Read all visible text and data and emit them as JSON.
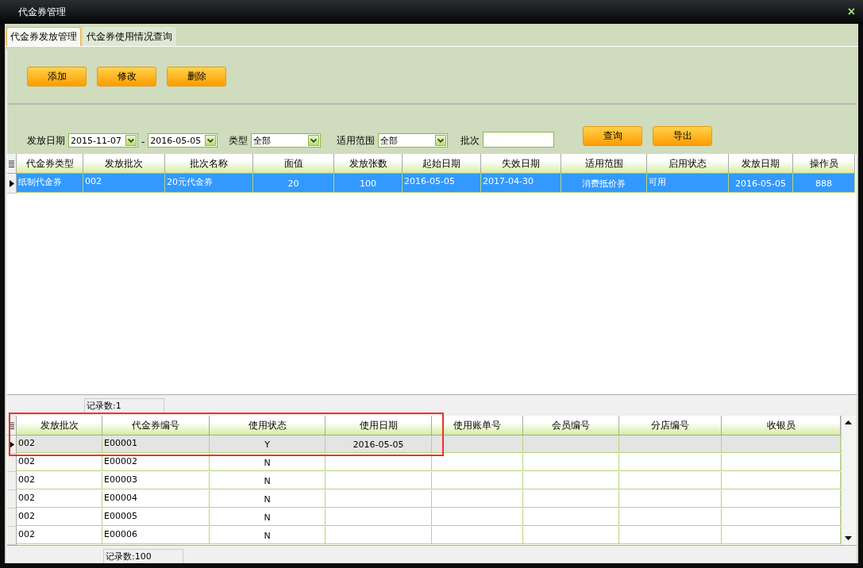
{
  "window": {
    "title": "代金券管理",
    "close": "×"
  },
  "tabs": [
    {
      "label": "代金券发放管理",
      "selected": true
    },
    {
      "label": "代金券使用情况查询",
      "selected": false
    }
  ],
  "toolbar": {
    "buttons": [
      "添加",
      "修改",
      "删除"
    ]
  },
  "filters": {
    "date_label": "发放日期",
    "date_from": "2015-11-07",
    "date_sep": "-",
    "date_to": "2016-05-05",
    "type_label": "类型",
    "type_value": "全部",
    "scope_label": "适用范围",
    "scope_value": "全部",
    "batch_label": "批次",
    "buttons": [
      "查询",
      "导出"
    ]
  },
  "issue_table": {
    "columns": [
      "代金券类型",
      "发放批次",
      "批次名称",
      "面值",
      "发放张数",
      "起始日期",
      "失效日期",
      "适用范围",
      "启用状态",
      "发放日期",
      "操作员"
    ],
    "rows": [
      {
        "selected": true,
        "cells": [
          "纸制代金券",
          "002",
          "20元代金券",
          "20",
          "100",
          "2016-05-05",
          "2017-04-30",
          "消费抵价券",
          "可用",
          "2016-05-05",
          "888"
        ]
      }
    ],
    "record_count": "记录数:1"
  },
  "usage_table": {
    "columns": [
      "发放批次",
      "代金券编号",
      "使用状态",
      "使用日期",
      "使用账单号",
      "会员编号",
      "分店编号",
      "收银员"
    ],
    "rows": [
      {
        "selected": true,
        "cells": [
          "002",
          "E00001",
          "Y",
          "2016-05-05",
          "",
          "",
          "",
          ""
        ]
      },
      {
        "selected": false,
        "cells": [
          "002",
          "E00002",
          "N",
          "",
          "",
          "",
          "",
          ""
        ]
      },
      {
        "selected": false,
        "cells": [
          "002",
          "E00003",
          "N",
          "",
          "",
          "",
          "",
          ""
        ]
      },
      {
        "selected": false,
        "cells": [
          "002",
          "E00004",
          "N",
          "",
          "",
          "",
          "",
          ""
        ]
      },
      {
        "selected": false,
        "cells": [
          "002",
          "E00005",
          "N",
          "",
          "",
          "",
          "",
          ""
        ]
      },
      {
        "selected": false,
        "cells": [
          "002",
          "E00006",
          "N",
          "",
          "",
          "",
          "",
          ""
        ]
      }
    ],
    "record_count": "记录数:100"
  }
}
